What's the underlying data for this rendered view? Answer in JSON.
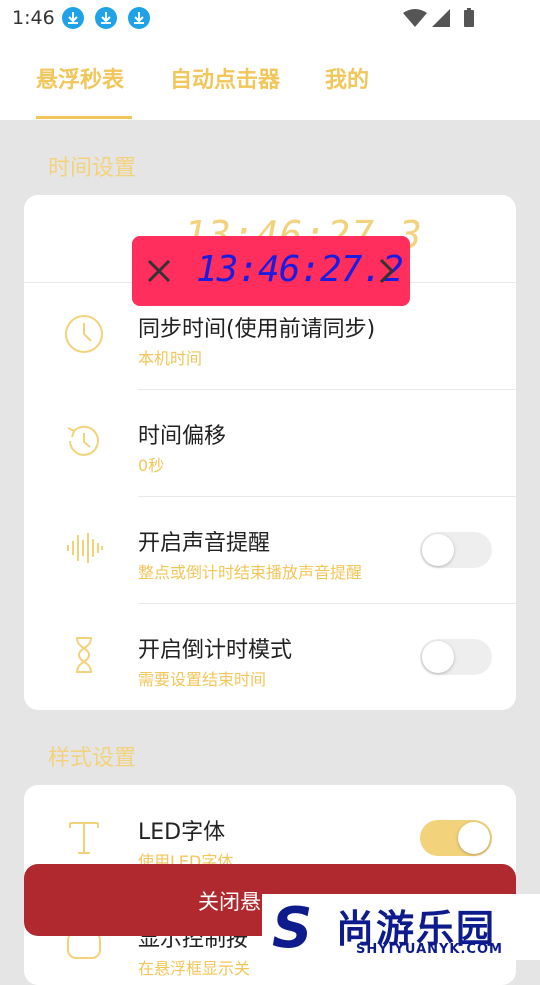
{
  "status": {
    "time": "1:46",
    "notification_icons": [
      "download-icon",
      "download-icon",
      "download-icon"
    ],
    "system_icons": [
      "wifi-icon",
      "signal-icon",
      "battery-icon"
    ]
  },
  "tabs": [
    {
      "label": "悬浮秒表",
      "active": true
    },
    {
      "label": "自动点击器",
      "active": false
    },
    {
      "label": "我的",
      "active": false
    }
  ],
  "section_time": {
    "title": "时间设置",
    "clock": "13:46:27.3",
    "rows": [
      {
        "title": "同步时间(使用前请同步)",
        "subtitle": "本机时间",
        "icon": "clock-icon"
      },
      {
        "title": "时间偏移",
        "subtitle": "0秒",
        "icon": "history-icon"
      },
      {
        "title": "开启声音提醒",
        "subtitle": "整点或倒计时结束播放声音提醒",
        "icon": "sound-wave-icon",
        "toggle": false
      },
      {
        "title": "开启倒计时模式",
        "subtitle": "需要设置结束时间",
        "icon": "hourglass-icon",
        "toggle": false
      }
    ]
  },
  "section_style": {
    "title": "样式设置",
    "rows": [
      {
        "title": "LED字体",
        "subtitle": "使用LED字体",
        "icon": "text-icon",
        "toggle": true
      },
      {
        "title": "显示控制按",
        "subtitle": "在悬浮框显示关",
        "icon": "control-icon"
      }
    ]
  },
  "floating_window": {
    "time": "13:46:27.2"
  },
  "bottom_button": {
    "label": "关闭悬"
  },
  "watermark": {
    "logo_letter": "S",
    "text": "尚游乐园",
    "url": "SHYIYUANYK.COM"
  },
  "colors": {
    "accent": "#f1c65a",
    "float_bg": "#ff2e5c",
    "float_text": "#1a1de0",
    "button_bg": "#b0292e"
  }
}
